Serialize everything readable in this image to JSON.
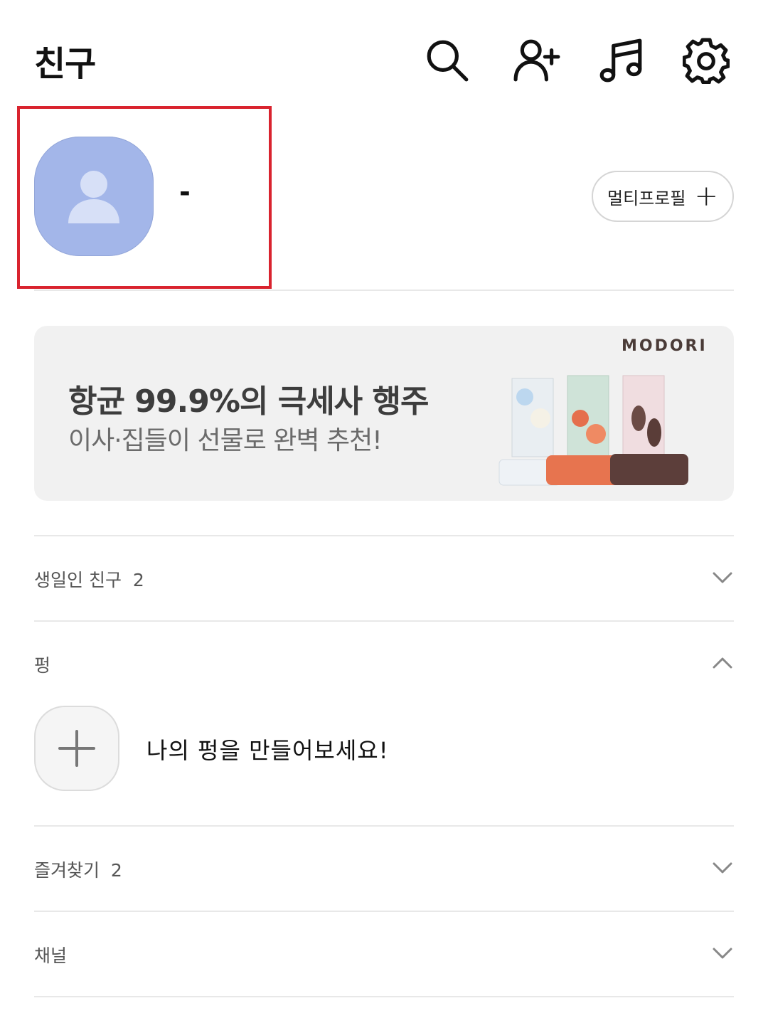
{
  "header": {
    "title": "친구",
    "icons": [
      "search-icon",
      "add-friend-icon",
      "music-icon",
      "settings-icon"
    ]
  },
  "profile": {
    "name": "-",
    "multi_profile_label": "멀티프로필"
  },
  "banner": {
    "brand": "MODORI",
    "title": "항균 99.9%의 극세사 행주",
    "subtitle": "이사·집들이 선물로 완벽 추천!"
  },
  "sections": {
    "birthday": {
      "label": "생일인 친구",
      "count": "2",
      "state": "collapsed"
    },
    "pung": {
      "label": "펑",
      "state": "expanded",
      "create_text": "나의 펑을 만들어보세요!"
    },
    "favorites": {
      "label": "즐겨찾기",
      "count": "2",
      "state": "collapsed"
    },
    "channel": {
      "label": "채널",
      "state": "collapsed"
    }
  },
  "colors": {
    "highlight": "#d9232e",
    "avatar": "#a3b6e9",
    "banner_bg": "#f1f1f1"
  }
}
